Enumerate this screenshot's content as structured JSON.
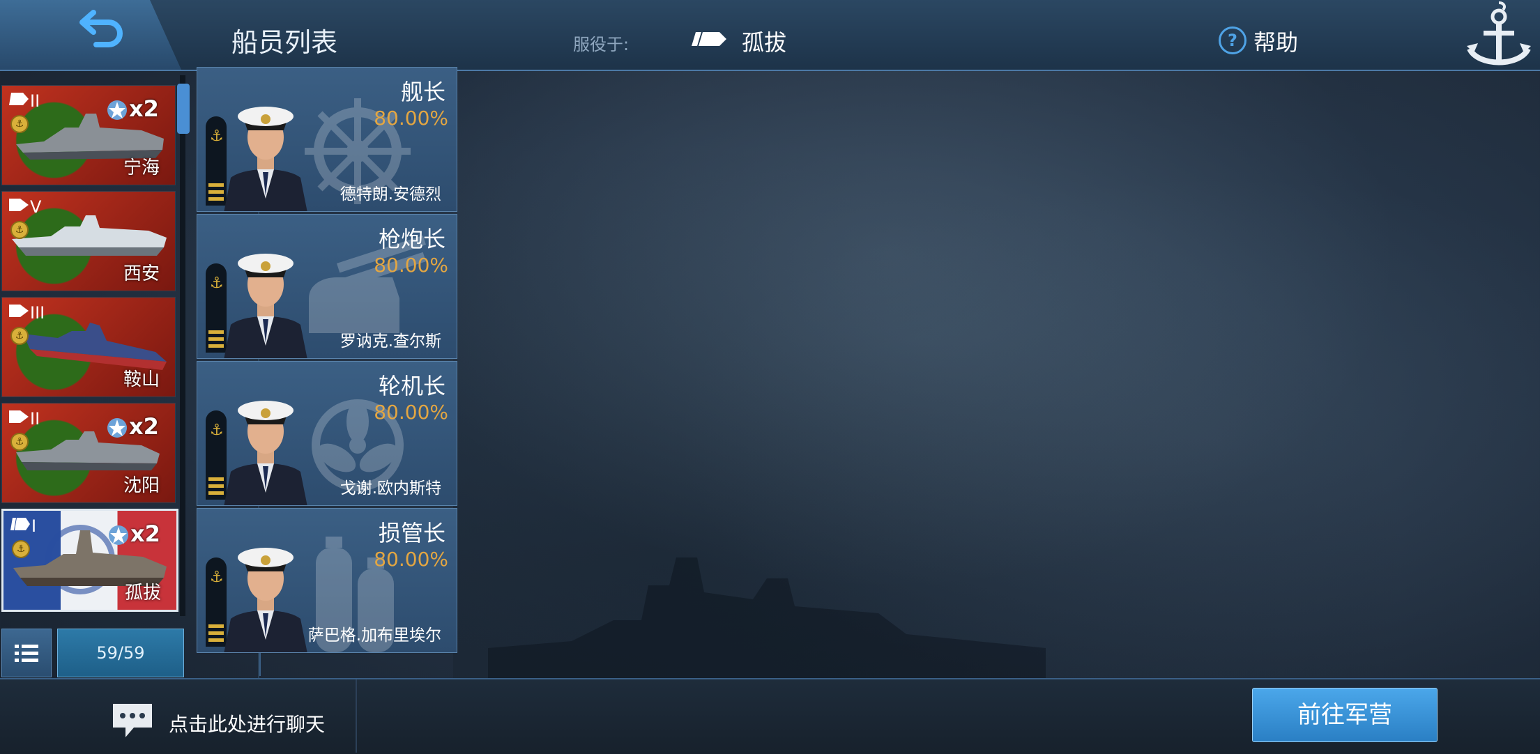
{
  "header": {
    "title": "船员列表",
    "service_label": "服役于:",
    "service_ship": "孤拔",
    "help_label": "帮助"
  },
  "ships": [
    {
      "name": "宁海",
      "tier": "II",
      "multiplier": "x2",
      "type_icon": "cruiser-icon",
      "flag_color": "#b02a1f",
      "selected": false
    },
    {
      "name": "西安",
      "tier": "V",
      "multiplier": "",
      "type_icon": "destroyer-icon",
      "flag_color": "#b02a1f",
      "selected": false
    },
    {
      "name": "鞍山",
      "tier": "III",
      "multiplier": "",
      "type_icon": "destroyer-icon",
      "flag_color": "#b02a1f",
      "selected": false
    },
    {
      "name": "沈阳",
      "tier": "II",
      "multiplier": "x2",
      "type_icon": "destroyer-icon",
      "flag_color": "#b02a1f",
      "selected": false
    },
    {
      "name": "孤拔",
      "tier": "I",
      "multiplier": "x2",
      "type_icon": "battleship-icon",
      "flag_color": "#2a4fa0",
      "selected": true
    }
  ],
  "ship_count": "59/59",
  "crew": [
    {
      "role": "舰长",
      "percent": "80.00%",
      "name": "德特朗.安德烈",
      "bg_icon": "ship-wheel-icon"
    },
    {
      "role": "枪炮长",
      "percent": "80.00%",
      "name": "罗讷克.查尔斯",
      "bg_icon": "gun-turret-icon"
    },
    {
      "role": "轮机长",
      "percent": "80.00%",
      "name": "戈谢.欧内斯特",
      "bg_icon": "propeller-icon"
    },
    {
      "role": "损管长",
      "percent": "80.00%",
      "name": "萨巴格.加布里埃尔",
      "bg_icon": "oxygen-tank-icon"
    }
  ],
  "footer": {
    "chat_label": "点击此处进行聊天",
    "barracks_label": "前往军营"
  },
  "colors": {
    "accent": "#4a8fd4",
    "percent": "#e3a642",
    "button": "#2a7fc4"
  }
}
